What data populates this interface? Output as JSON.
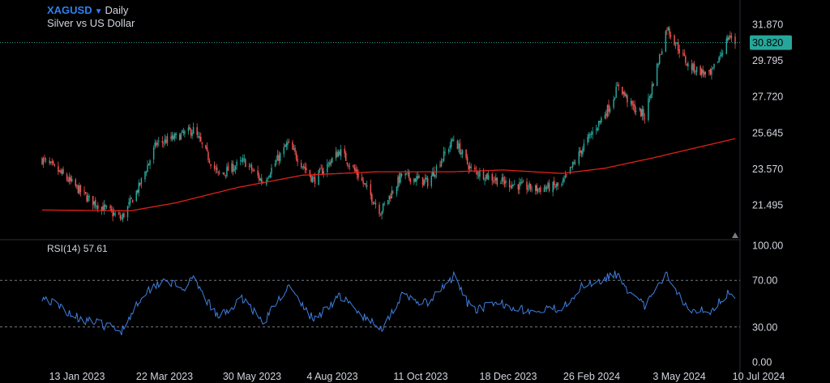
{
  "header": {
    "symbol": "XAGUSD",
    "timeframe": "Daily",
    "description": "Silver vs US Dollar"
  },
  "indicator": {
    "label": "RSI(14)",
    "value": "57.61"
  },
  "colors": {
    "background": "#000000",
    "candle_up": "#26a69a",
    "candle_down": "#ef5350",
    "ma_line": "#e0201b",
    "rsi_line": "#3f7fe0",
    "last_price_tag": "#26a69a"
  },
  "chart_data": [
    {
      "type": "candlestick",
      "title": "",
      "x_ticks": [
        "13 Jan 2023",
        "22 Mar 2023",
        "30 May 2023",
        "4 Aug 2023",
        "11 Oct 2023",
        "18 Dec 2023",
        "26 Feb 2024",
        "3 May 2024",
        "10 Jul 2024"
      ],
      "y_ticks": [
        "31.870",
        "29.795",
        "27.720",
        "25.645",
        "23.570",
        "21.495"
      ],
      "ylim": [
        20.7,
        32.9
      ],
      "last_price": "30.820",
      "close_anchors": [
        {
          "x": "2023-01-03",
          "y": 24.1
        },
        {
          "x": "2023-01-20",
          "y": 23.2
        },
        {
          "x": "2023-02-10",
          "y": 21.8
        },
        {
          "x": "2023-03-08",
          "y": 20.7
        },
        {
          "x": "2023-03-22",
          "y": 22.5
        },
        {
          "x": "2023-04-05",
          "y": 25.0
        },
        {
          "x": "2023-04-18",
          "y": 25.3
        },
        {
          "x": "2023-05-05",
          "y": 25.8
        },
        {
          "x": "2023-05-25",
          "y": 23.2
        },
        {
          "x": "2023-06-15",
          "y": 24.0
        },
        {
          "x": "2023-06-30",
          "y": 22.8
        },
        {
          "x": "2023-07-20",
          "y": 25.0
        },
        {
          "x": "2023-08-10",
          "y": 22.9
        },
        {
          "x": "2023-08-31",
          "y": 24.6
        },
        {
          "x": "2023-09-15",
          "y": 23.2
        },
        {
          "x": "2023-10-03",
          "y": 21.1
        },
        {
          "x": "2023-10-20",
          "y": 23.2
        },
        {
          "x": "2023-11-10",
          "y": 22.8
        },
        {
          "x": "2023-12-01",
          "y": 25.3
        },
        {
          "x": "2023-12-15",
          "y": 23.5
        },
        {
          "x": "2024-01-10",
          "y": 22.8
        },
        {
          "x": "2024-02-05",
          "y": 22.4
        },
        {
          "x": "2024-02-26",
          "y": 22.6
        },
        {
          "x": "2024-03-15",
          "y": 24.9
        },
        {
          "x": "2024-04-05",
          "y": 27.2
        },
        {
          "x": "2024-04-12",
          "y": 28.4
        },
        {
          "x": "2024-04-22",
          "y": 27.2
        },
        {
          "x": "2024-05-03",
          "y": 26.6
        },
        {
          "x": "2024-05-21",
          "y": 31.7
        },
        {
          "x": "2024-06-07",
          "y": 29.5
        },
        {
          "x": "2024-06-25",
          "y": 28.9
        },
        {
          "x": "2024-07-10",
          "y": 31.2
        },
        {
          "x": "2024-07-15",
          "y": 30.8
        }
      ],
      "moving_average": [
        {
          "x": "2023-01-03",
          "y": 21.2
        },
        {
          "x": "2023-03-15",
          "y": 21.15
        },
        {
          "x": "2023-04-20",
          "y": 21.6
        },
        {
          "x": "2023-06-10",
          "y": 22.5
        },
        {
          "x": "2023-08-01",
          "y": 23.2
        },
        {
          "x": "2023-10-01",
          "y": 23.4
        },
        {
          "x": "2023-12-01",
          "y": 23.4
        },
        {
          "x": "2024-01-10",
          "y": 23.5
        },
        {
          "x": "2024-02-26",
          "y": 23.3
        },
        {
          "x": "2024-04-01",
          "y": 23.6
        },
        {
          "x": "2024-05-10",
          "y": 24.2
        },
        {
          "x": "2024-07-15",
          "y": 25.3
        }
      ]
    },
    {
      "type": "line",
      "title": "",
      "series": [
        {
          "name": "",
          "values": []
        }
      ],
      "y_ticks": [
        "100.00",
        "70.00",
        "30.00",
        "0.00"
      ],
      "ylim": [
        0,
        100
      ],
      "bands": [
        30,
        70
      ],
      "rsi_anchors": [
        {
          "x": "2023-01-03",
          "y": 56
        },
        {
          "x": "2023-02-01",
          "y": 38
        },
        {
          "x": "2023-03-08",
          "y": 27
        },
        {
          "x": "2023-03-25",
          "y": 58
        },
        {
          "x": "2023-04-12",
          "y": 72
        },
        {
          "x": "2023-04-25",
          "y": 62
        },
        {
          "x": "2023-05-05",
          "y": 70
        },
        {
          "x": "2023-05-25",
          "y": 38
        },
        {
          "x": "2023-06-15",
          "y": 55
        },
        {
          "x": "2023-06-30",
          "y": 33
        },
        {
          "x": "2023-07-20",
          "y": 65
        },
        {
          "x": "2023-08-10",
          "y": 36
        },
        {
          "x": "2023-08-31",
          "y": 57
        },
        {
          "x": "2023-09-15",
          "y": 42
        },
        {
          "x": "2023-10-03",
          "y": 28
        },
        {
          "x": "2023-10-20",
          "y": 56
        },
        {
          "x": "2023-11-10",
          "y": 50
        },
        {
          "x": "2023-12-01",
          "y": 73
        },
        {
          "x": "2023-12-15",
          "y": 45
        },
        {
          "x": "2024-01-10",
          "y": 50
        },
        {
          "x": "2024-02-05",
          "y": 42
        },
        {
          "x": "2024-02-26",
          "y": 47
        },
        {
          "x": "2024-03-15",
          "y": 66
        },
        {
          "x": "2024-04-12",
          "y": 76
        },
        {
          "x": "2024-04-22",
          "y": 57
        },
        {
          "x": "2024-05-03",
          "y": 48
        },
        {
          "x": "2024-05-21",
          "y": 75
        },
        {
          "x": "2024-06-07",
          "y": 46
        },
        {
          "x": "2024-06-25",
          "y": 44
        },
        {
          "x": "2024-07-10",
          "y": 60
        },
        {
          "x": "2024-07-15",
          "y": 57.6
        }
      ]
    }
  ]
}
